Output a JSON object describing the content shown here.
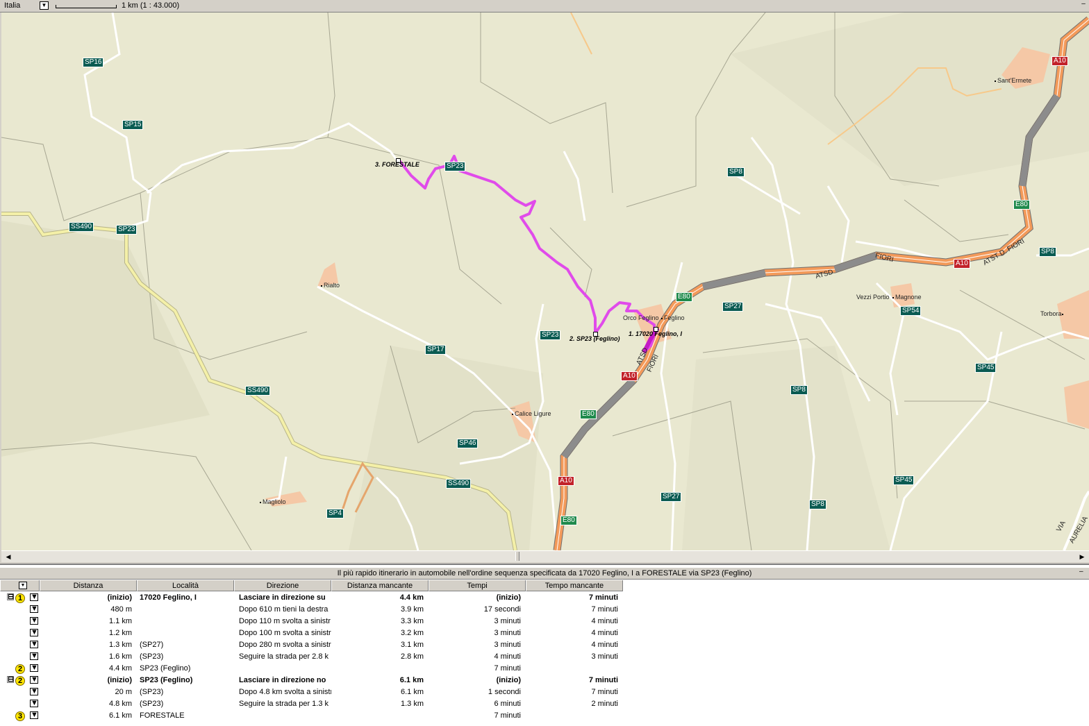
{
  "topbar": {
    "country": "Italia",
    "scale": "1 km  (1 : 43.000)",
    "collapse_icon": "minus-icon"
  },
  "map": {
    "colors": {
      "background": "#e9e8d0",
      "minor_road": "#ffffff",
      "secondary_road": "#f4f0a8",
      "route": "#e04bea",
      "motorway_orange": "#f39a5a",
      "motorway_gray": "#8c8c8c",
      "town_area": "#f5c8a6"
    },
    "road_labels": [
      {
        "id": "sp16",
        "text": "SP16",
        "type": "sp"
      },
      {
        "id": "sp15",
        "text": "SP15",
        "type": "sp"
      },
      {
        "id": "ss490a",
        "text": "SS490",
        "type": "sp"
      },
      {
        "id": "sp23a",
        "text": "SP23",
        "type": "sp"
      },
      {
        "id": "sp23b",
        "text": "SP23",
        "type": "sp"
      },
      {
        "id": "sp23c",
        "text": "SP23",
        "type": "sp"
      },
      {
        "id": "sp17",
        "text": "SP17",
        "type": "sp"
      },
      {
        "id": "ss490b",
        "text": "SS490",
        "type": "sp"
      },
      {
        "id": "sp46",
        "text": "SP46",
        "type": "sp"
      },
      {
        "id": "ss490c",
        "text": "SS490",
        "type": "sp"
      },
      {
        "id": "sp4",
        "text": "SP4",
        "type": "sp"
      },
      {
        "id": "sp8a",
        "text": "SP8",
        "type": "sp"
      },
      {
        "id": "sp27a",
        "text": "SP27",
        "type": "sp"
      },
      {
        "id": "sp8b",
        "text": "SP8",
        "type": "sp"
      },
      {
        "id": "sp27b",
        "text": "SP27",
        "type": "sp"
      },
      {
        "id": "sp8c",
        "text": "SP8",
        "type": "sp"
      },
      {
        "id": "sp54",
        "text": "SP54",
        "type": "sp"
      },
      {
        "id": "sp45a",
        "text": "SP45",
        "type": "sp"
      },
      {
        "id": "sp45b",
        "text": "SP45",
        "type": "sp"
      },
      {
        "id": "sp8d",
        "text": "SP8",
        "type": "sp"
      },
      {
        "id": "e80a",
        "text": "E80",
        "type": "e"
      },
      {
        "id": "e80b",
        "text": "E80",
        "type": "e"
      },
      {
        "id": "e80c",
        "text": "E80",
        "type": "e"
      },
      {
        "id": "e80d",
        "text": "E80",
        "type": "e"
      },
      {
        "id": "a10a",
        "text": "A10",
        "type": "a"
      },
      {
        "id": "a10b",
        "text": "A10",
        "type": "a"
      },
      {
        "id": "a10c",
        "text": "A10",
        "type": "a"
      },
      {
        "id": "a10d",
        "text": "A10",
        "type": "a"
      }
    ],
    "places": [
      {
        "id": "rialto",
        "text": "Rialto"
      },
      {
        "id": "calice",
        "text": "Calice Ligure"
      },
      {
        "id": "magliolo",
        "text": "Magliolo"
      },
      {
        "id": "orco",
        "text": "Orco Feglino"
      },
      {
        "id": "feglino",
        "text": "Feglino"
      },
      {
        "id": "vezzi",
        "text": "Vezzi Portio"
      },
      {
        "id": "magnone",
        "text": "Magnone"
      },
      {
        "id": "torbora",
        "text": "Torbora"
      },
      {
        "id": "santermete",
        "text": "Sant'Ermete"
      }
    ],
    "waypoints": [
      {
        "id": "wp1",
        "text": "1. 17020 Feglino, I"
      },
      {
        "id": "wp2",
        "text": "2. SP23 (Feglino)"
      },
      {
        "id": "wp3",
        "text": "3. FORESTALE"
      }
    ],
    "highway_names": [
      {
        "id": "atsd1",
        "text": "ATSD"
      },
      {
        "id": "fiori1",
        "text": "FIORI"
      },
      {
        "id": "atsd2",
        "text": "ATSD"
      },
      {
        "id": "fiori2",
        "text": "FIORI"
      },
      {
        "id": "atstd",
        "text": "ATST D. FIORI"
      },
      {
        "id": "via",
        "text": "VIA"
      },
      {
        "id": "aurelia",
        "text": "AURELIA"
      }
    ]
  },
  "panel": {
    "title": "Il più rapido itinerario in automobile nell'ordine sequenza specificata da 17020 Feglino, I a FORESTALE via SP23 (Feglino)",
    "columns": [
      "Distanza",
      "Località",
      "Direzione",
      "Distanza mancante",
      "Tempi",
      "Tempo mancante"
    ],
    "rows": [
      {
        "badge": "1",
        "expander": "⊟",
        "bold": true,
        "dist": "(inizio)",
        "loc": "17020 Feglino, I",
        "dir": "Lasciare in direzione su",
        "rem": "4.4 km",
        "time": "(inizio)",
        "trem": "7 minuti"
      },
      {
        "badge": "",
        "expander": "",
        "bold": false,
        "dist": "480 m",
        "loc": "",
        "dir": "Dopo 610 m tieni la destra",
        "rem": "3.9 km",
        "time": "17 secondi",
        "trem": "7 minuti"
      },
      {
        "badge": "",
        "expander": "",
        "bold": false,
        "dist": "1.1 km",
        "loc": "",
        "dir": "Dopo 110 m svolta a sinistr",
        "rem": "3.3 km",
        "time": "3 minuti",
        "trem": "4 minuti"
      },
      {
        "badge": "",
        "expander": "",
        "bold": false,
        "dist": "1.2 km",
        "loc": "",
        "dir": "Dopo 100 m svolta a sinistr",
        "rem": "3.2 km",
        "time": "3 minuti",
        "trem": "4 minuti"
      },
      {
        "badge": "",
        "expander": "",
        "bold": false,
        "dist": "1.3 km",
        "loc": "(SP27)",
        "dir": "Dopo 280 m svolta a sinistr",
        "rem": "3.1 km",
        "time": "3 minuti",
        "trem": "4 minuti"
      },
      {
        "badge": "",
        "expander": "",
        "bold": false,
        "dist": "1.6 km",
        "loc": "(SP23)",
        "dir": "Seguire la strada per 2.8 k",
        "rem": "2.8 km",
        "time": "4 minuti",
        "trem": "3 minuti"
      },
      {
        "badge": "2",
        "expander": "",
        "bold": false,
        "dist": "4.4 km",
        "loc": "SP23 (Feglino)",
        "dir": "",
        "rem": "",
        "time": "7 minuti",
        "trem": ""
      },
      {
        "badge": "2",
        "expander": "⊟",
        "bold": true,
        "dist": "(inizio)",
        "loc": "SP23 (Feglino)",
        "dir": "Lasciare in direzione no",
        "rem": "6.1 km",
        "time": "(inizio)",
        "trem": "7 minuti"
      },
      {
        "badge": "",
        "expander": "",
        "bold": false,
        "dist": "20 m",
        "loc": "(SP23)",
        "dir": "Dopo 4.8 km svolta a sinistr",
        "rem": "6.1 km",
        "time": "1 secondi",
        "trem": "7 minuti"
      },
      {
        "badge": "",
        "expander": "",
        "bold": false,
        "dist": "4.8 km",
        "loc": "(SP23)",
        "dir": "Seguire la strada per 1.3 k",
        "rem": "1.3 km",
        "time": "6 minuti",
        "trem": "2 minuti"
      },
      {
        "badge": "3",
        "expander": "",
        "bold": false,
        "dist": "6.1 km",
        "loc": "FORESTALE",
        "dir": "",
        "rem": "",
        "time": "7 minuti",
        "trem": ""
      }
    ]
  }
}
